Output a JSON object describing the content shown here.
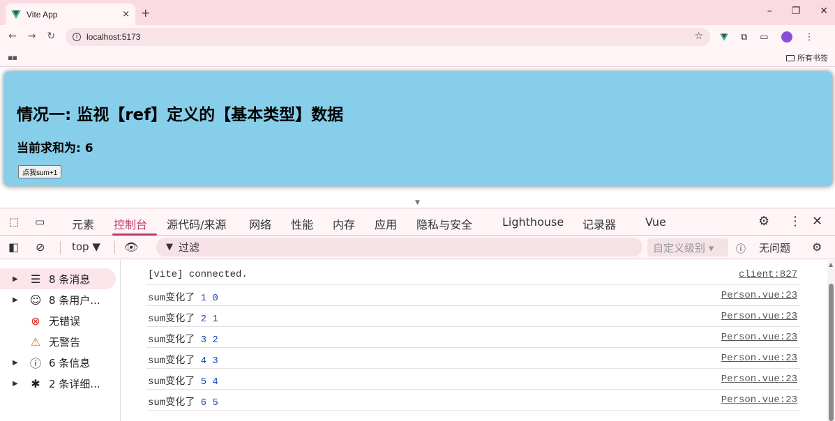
{
  "browser": {
    "tab_title": "Vite App",
    "tab_close": "×",
    "new_tab": "+",
    "url": "localhost:5173",
    "bookmarks_all": "所有书签",
    "window_minimize": "–",
    "window_restore": "❐",
    "window_close": "✕"
  },
  "page": {
    "heading": "情况一: 监视【ref】定义的【基本类型】数据",
    "sum_text": "当前求和为: 6",
    "button_label": "点我sum+1",
    "card_color": "#87ceeb"
  },
  "devtools": {
    "tabs": [
      "元素",
      "控制台",
      "源代码/来源",
      "网络",
      "性能",
      "内存",
      "应用",
      "隐私与安全",
      "Lighthouse",
      "记录器",
      "Vue"
    ],
    "active_tab": "控制台",
    "context": "top ▼",
    "filter_placeholder": "过滤",
    "levels": "自定义级别 ▾",
    "issues": "无问题",
    "accent": "#c0396b"
  },
  "sidebar": {
    "items": [
      {
        "label": "8 条消息",
        "icon": "list-icon",
        "glyph": "☰",
        "caret": "▶",
        "selected": true
      },
      {
        "label": "8 条用户...",
        "icon": "user-icon",
        "glyph": "☺",
        "caret": "▶",
        "selected": false
      },
      {
        "label": "无错误",
        "icon": "error-icon",
        "glyph": "⊗",
        "caret": "",
        "selected": false
      },
      {
        "label": "无警告",
        "icon": "warning-icon",
        "glyph": "⚠",
        "caret": "",
        "selected": false
      },
      {
        "label": "6 条信息",
        "icon": "info-icon",
        "glyph": "ⓘ",
        "caret": "▶",
        "selected": false
      },
      {
        "label": "2 条详细...",
        "icon": "bug-icon",
        "glyph": "✱",
        "caret": "▶",
        "selected": false
      }
    ]
  },
  "console": {
    "rows": [
      {
        "text": "[vite] connected.",
        "nums": "",
        "source": "client:827"
      },
      {
        "text": "sum变化了",
        "nums": "1 0",
        "source": "Person.vue:23"
      },
      {
        "text": "sum变化了",
        "nums": "2 1",
        "source": "Person.vue:23"
      },
      {
        "text": "sum变化了",
        "nums": "3 2",
        "source": "Person.vue:23"
      },
      {
        "text": "sum变化了",
        "nums": "4 3",
        "source": "Person.vue:23"
      },
      {
        "text": "sum变化了",
        "nums": "5 4",
        "source": "Person.vue:23"
      },
      {
        "text": "sum变化了",
        "nums": "6 5",
        "source": "Person.vue:23"
      }
    ]
  }
}
